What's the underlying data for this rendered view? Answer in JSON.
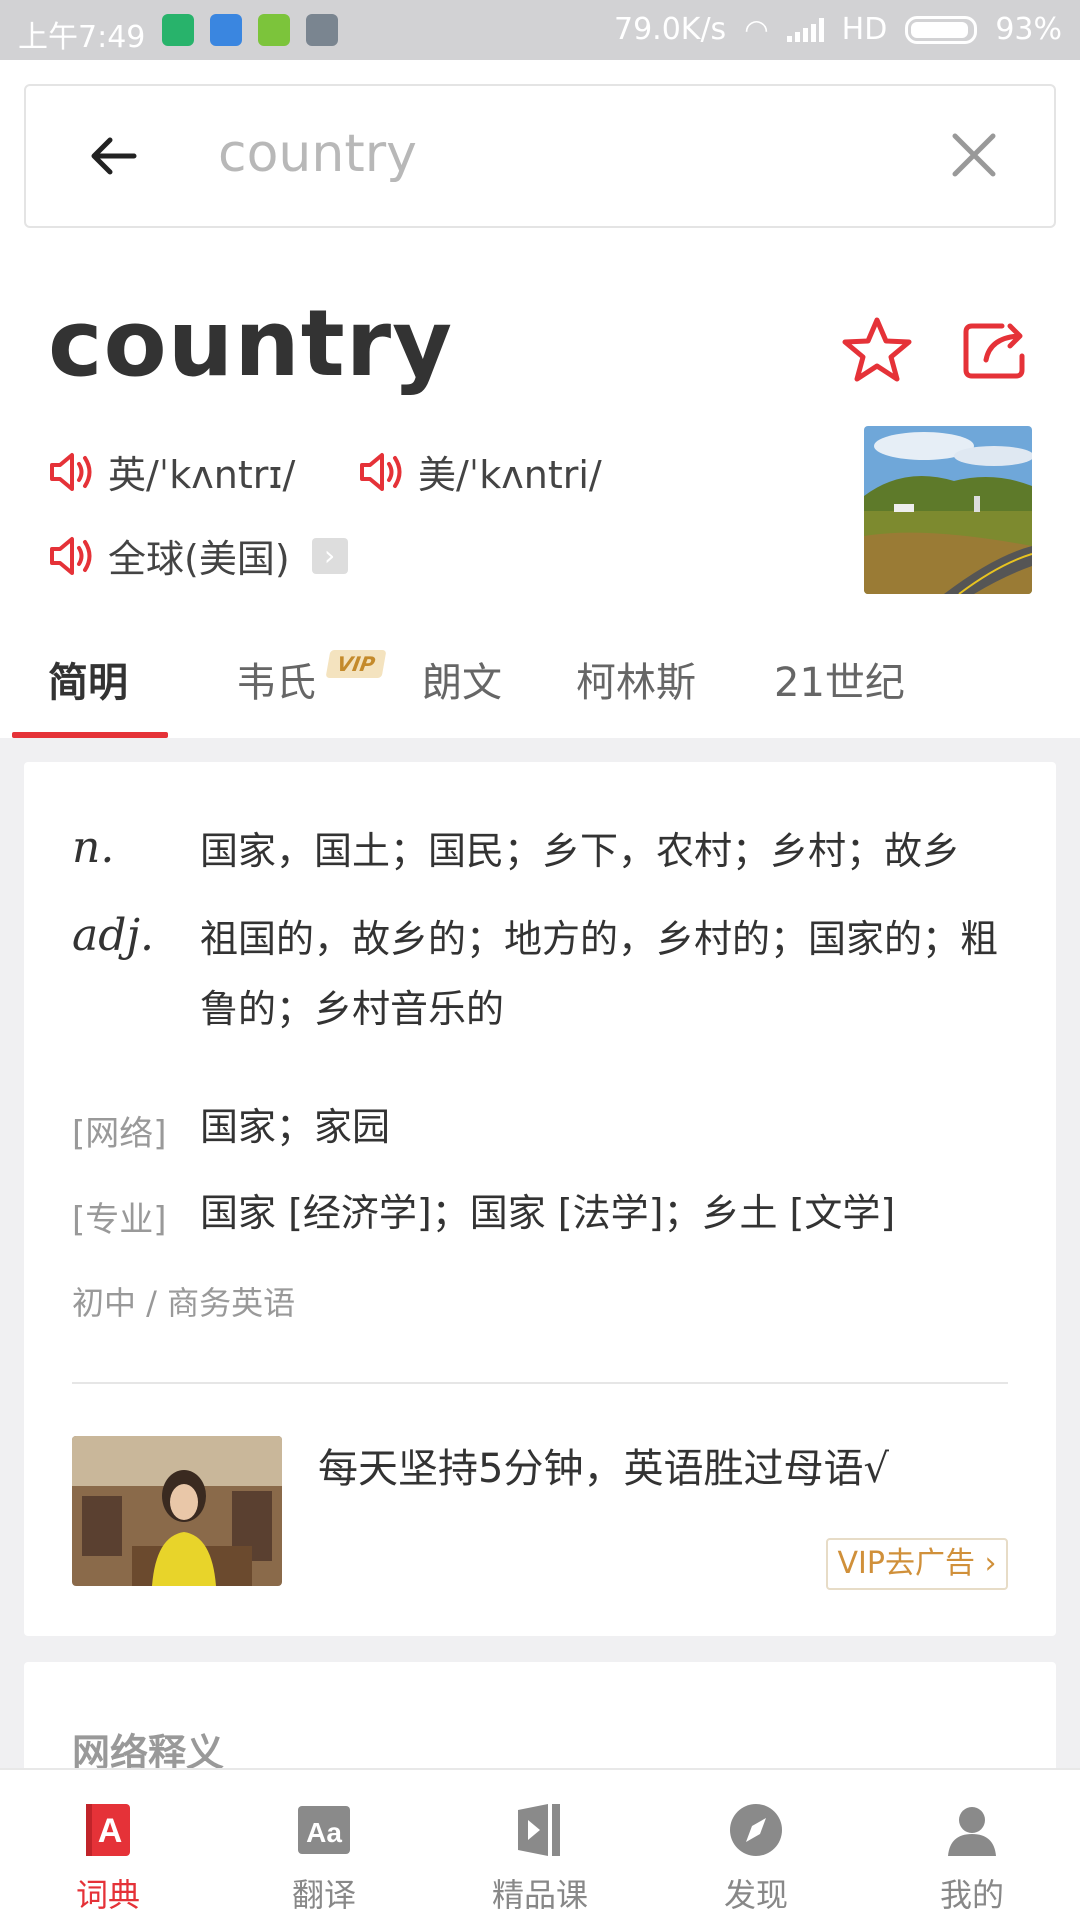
{
  "status_bar": {
    "time": "上午7:49",
    "network_speed": "79.0K/s",
    "hd": "HD",
    "battery": "93%"
  },
  "search": {
    "query": "country",
    "back_icon": "back-arrow-icon",
    "clear_icon": "close-icon"
  },
  "word": {
    "headword": "country",
    "uk_pron": "英/ˈkʌntrɪ/",
    "us_pron": "美/ˈkʌntri/",
    "global_pron": "全球(美国)"
  },
  "tabs": [
    {
      "label": "简明",
      "active": true
    },
    {
      "label": "韦氏",
      "badge": "VIP"
    },
    {
      "label": "朗文"
    },
    {
      "label": "柯林斯"
    },
    {
      "label": "21世纪"
    }
  ],
  "definitions": {
    "noun_pos": "n.",
    "noun_def": "国家，国土；国民；乡下，农村；乡村；故乡",
    "adj_pos": "adj.",
    "adj_def": "祖国的，故乡的；地方的，乡村的；国家的；粗鲁的；乡村音乐的",
    "web_label": "[网络]",
    "web_def": "国家；家园",
    "pro_label": "[专业]",
    "pro_def": "国家 [经济学]；国家 [法学]；乡土 [文学]",
    "tags": "初中 / 商务英语"
  },
  "ad": {
    "text": "每天坚持5分钟，英语胜过母语√",
    "button": "VIP去广告"
  },
  "next_section": {
    "title": "网络释义"
  },
  "bottom_nav": [
    {
      "label": "词典",
      "icon": "dictionary-icon",
      "active": true
    },
    {
      "label": "翻译",
      "icon": "translate-icon"
    },
    {
      "label": "精品课",
      "icon": "course-icon"
    },
    {
      "label": "发现",
      "icon": "compass-icon"
    },
    {
      "label": "我的",
      "icon": "profile-icon"
    }
  ],
  "colors": {
    "accent": "#e53238",
    "vip_gold": "#d0903a"
  }
}
